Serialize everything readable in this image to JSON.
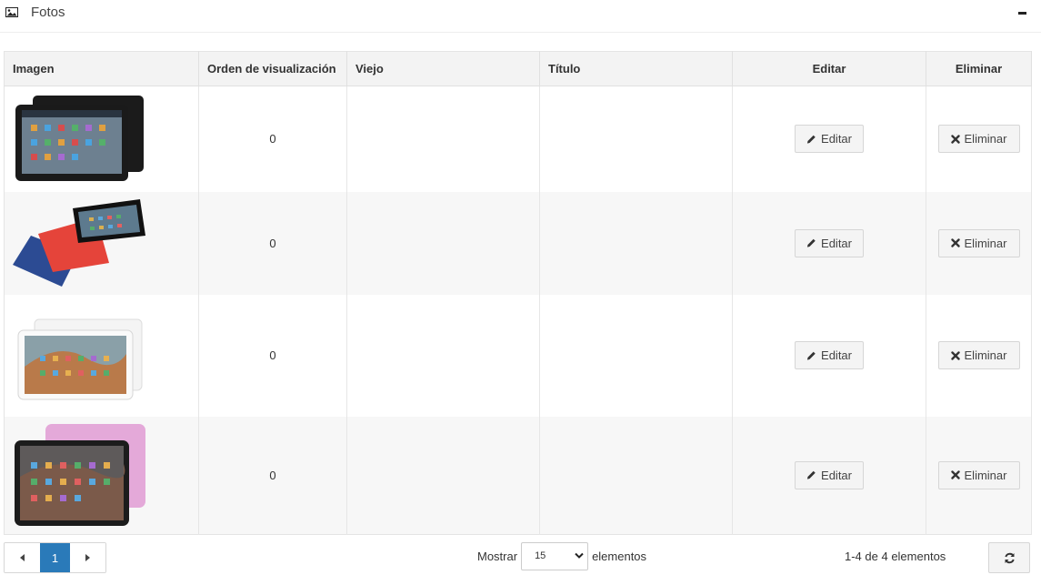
{
  "panel": {
    "title": "Fotos",
    "icon": "image-icon"
  },
  "table": {
    "columns": [
      "Imagen",
      "Orden de visualización",
      "Viejo",
      "Título",
      "Editar",
      "Eliminar"
    ],
    "rows": [
      {
        "image": "black tablet with home screen",
        "order": "0",
        "old": "",
        "title": "",
        "edit_label": "Editar",
        "delete_label": "Eliminar"
      },
      {
        "image": "blue, red and black tablets",
        "order": "0",
        "old": "",
        "title": "",
        "edit_label": "Editar",
        "delete_label": "Eliminar"
      },
      {
        "image": "white tablets with home screen",
        "order": "0",
        "old": "",
        "title": "",
        "edit_label": "Editar",
        "delete_label": "Eliminar"
      },
      {
        "image": "pink tablet with home screen",
        "order": "0",
        "old": "",
        "title": "",
        "edit_label": "Editar",
        "delete_label": "Eliminar"
      }
    ]
  },
  "pagination": {
    "current_page": "1",
    "prev_icon": "caret-left-icon",
    "next_icon": "caret-right-icon"
  },
  "page_size": {
    "prefix": "Mostrar",
    "value": "15",
    "suffix": "elementos"
  },
  "range_info": "1-4 de 4 elementos",
  "colors": {
    "accent": "#2a7ab9",
    "header_bg": "#f3f3f3",
    "row_alt": "#f7f7f7"
  }
}
